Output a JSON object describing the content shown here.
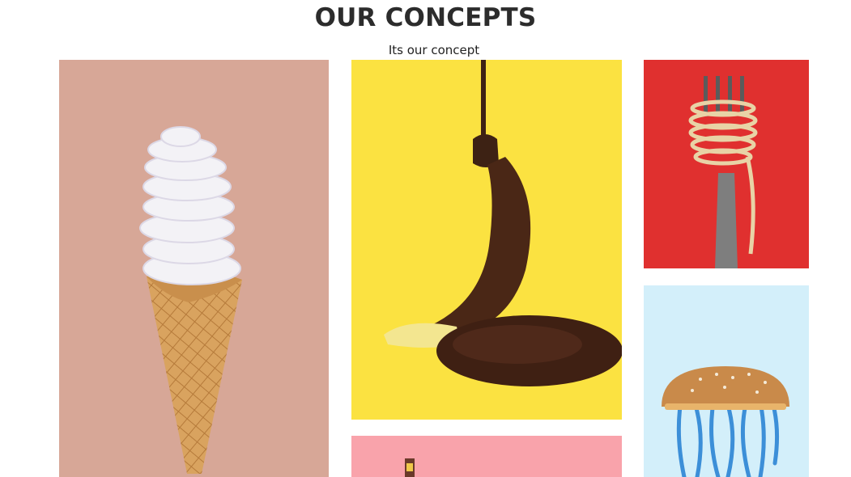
{
  "section": {
    "title": "OUR CONCEPTS",
    "subtitle": "Its our concept"
  },
  "gallery": [
    {
      "image": "lightbulb-ice-cream-cone",
      "background": "#d7a797"
    },
    {
      "image": "chocolate-dipped-banana",
      "background": "#fbe241"
    },
    {
      "image": "pink-concept-image",
      "background": "#f9a3ab"
    },
    {
      "image": "fork-with-cable-spaghetti",
      "background": "#e0302f"
    },
    {
      "image": "burger-jellyfish",
      "background": "#d3effa"
    }
  ]
}
